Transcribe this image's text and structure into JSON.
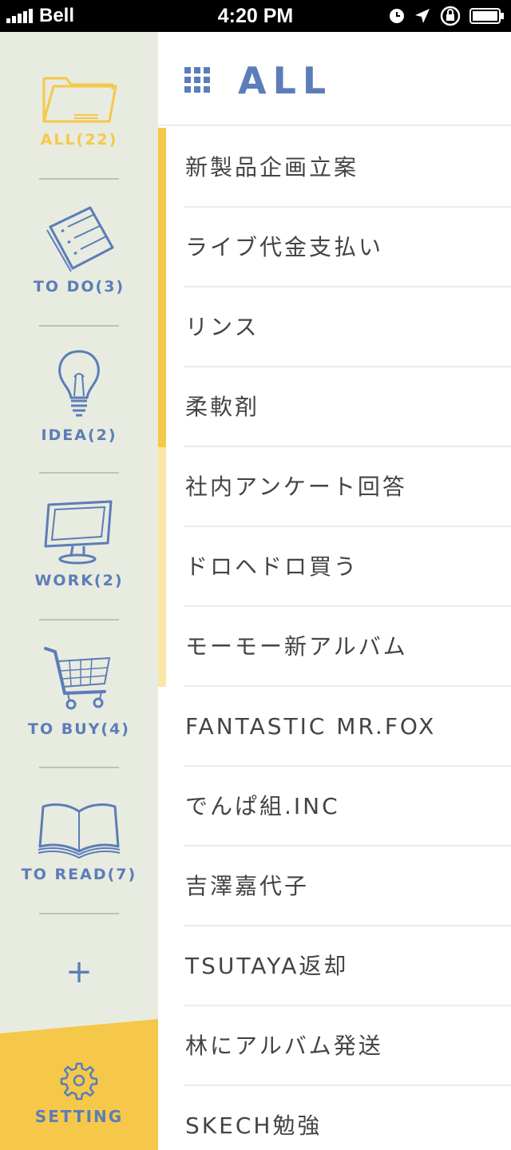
{
  "status_bar": {
    "carrier": "Bell",
    "time": "4:20 PM"
  },
  "sidebar": {
    "categories": [
      {
        "label": "ALL(22)",
        "icon": "folder-icon",
        "active": true
      },
      {
        "label": "TO DO(3)",
        "icon": "notepad-icon",
        "active": false
      },
      {
        "label": "IDEA(2)",
        "icon": "lightbulb-icon",
        "active": false
      },
      {
        "label": "WORK(2)",
        "icon": "monitor-icon",
        "active": false
      },
      {
        "label": "TO BUY(4)",
        "icon": "shopping-cart-icon",
        "active": false
      },
      {
        "label": "TO READ(7)",
        "icon": "book-icon",
        "active": false
      }
    ],
    "add_label": "+",
    "setting_label": "SETTING"
  },
  "header": {
    "title": "ALL"
  },
  "tasks": [
    "新製品企画立案",
    "ライブ代金支払い",
    "リンス",
    "柔軟剤",
    "社内アンケート回答",
    "ドロヘドロ買う",
    "モーモー新アルバム",
    "FANTASTIC MR.FOX",
    "でんぱ組.INC",
    "吉澤嘉代子",
    "TSUTAYA返却",
    "林にアルバム発送",
    "SKECH勉強"
  ],
  "colors": {
    "accent_blue": "#5b7db8",
    "accent_yellow": "#f5c84a",
    "sidebar_bg": "#e8ebdf",
    "scroll_track": "#fbe6a6"
  }
}
